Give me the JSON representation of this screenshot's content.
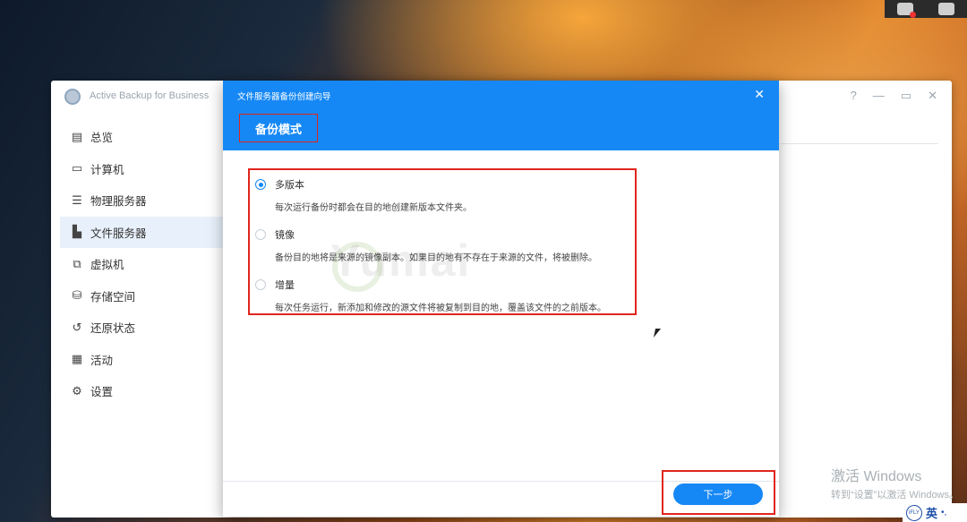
{
  "window": {
    "title": "Active Backup for Business",
    "controls": [
      "?",
      "—",
      "▭",
      "✕"
    ]
  },
  "sidebar": {
    "items": [
      {
        "label": "总览",
        "icon": "overview-icon",
        "glyph": "▤"
      },
      {
        "label": "计算机",
        "icon": "computer-icon",
        "glyph": "▭"
      },
      {
        "label": "物理服务器",
        "icon": "server-icon",
        "glyph": "☰"
      },
      {
        "label": "文件服务器",
        "icon": "file-server-icon",
        "glyph": "▙"
      },
      {
        "label": "虚拟机",
        "icon": "virtual-machine-icon",
        "glyph": "⧉"
      },
      {
        "label": "存储空间",
        "icon": "storage-icon",
        "glyph": "⛁"
      },
      {
        "label": "还原状态",
        "icon": "restore-icon",
        "glyph": "↺"
      },
      {
        "label": "活动",
        "icon": "activity-icon",
        "glyph": "▦"
      },
      {
        "label": "设置",
        "icon": "gear-icon",
        "glyph": "⚙"
      }
    ],
    "active_index": 3
  },
  "dialog": {
    "title": "文件服务器备份创建向导",
    "close": "✕",
    "section_title": "备份模式",
    "options": [
      {
        "label": "多版本",
        "desc": "每次运行备份时都会在目的地创建新版本文件夹。",
        "checked": true
      },
      {
        "label": "镜像",
        "desc": "备份目的地将是来源的镜像副本。如果目的地有不存在于来源的文件，将被删除。",
        "checked": false
      },
      {
        "label": "增量",
        "desc": "每次任务运行，新添加和修改的源文件将被复制到目的地，覆盖该文件的之前版本。",
        "checked": false
      }
    ],
    "next_button": "下一步"
  },
  "watermark": "Yumai",
  "os": {
    "activate_line1": "激活 Windows",
    "activate_line2": "转到“设置”以激活 Windows。",
    "ime_logo": "iFLY",
    "ime_lang": "英",
    "ime_extra": "•,"
  },
  "colors": {
    "accent": "#1688f5",
    "highlight_border": "#e0261d"
  }
}
